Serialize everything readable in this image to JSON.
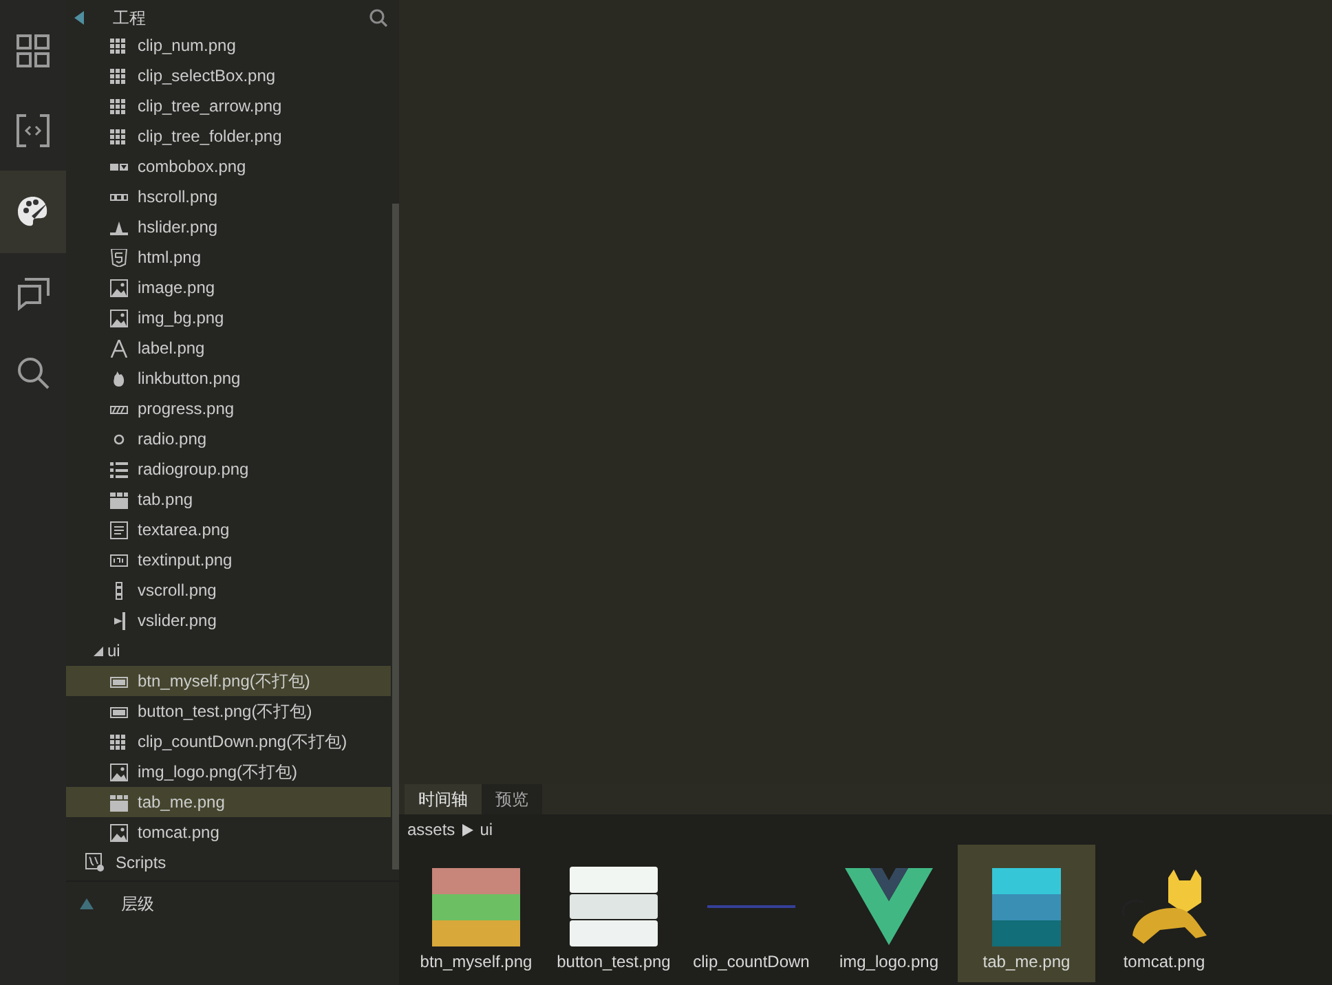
{
  "activity_bar": [
    {
      "kind": "grid",
      "selected": false
    },
    {
      "kind": "code",
      "selected": false
    },
    {
      "kind": "palette",
      "selected": true
    },
    {
      "kind": "chat",
      "selected": false
    },
    {
      "kind": "search",
      "selected": false
    }
  ],
  "project_panel": {
    "title": "工程",
    "expanded": true,
    "items": [
      {
        "label": "clip_num.png",
        "kind": "clip",
        "selected": false
      },
      {
        "label": "clip_selectBox.png",
        "kind": "clip",
        "selected": false
      },
      {
        "label": "clip_tree_arrow.png",
        "kind": "clip",
        "selected": false
      },
      {
        "label": "clip_tree_folder.png",
        "kind": "clip",
        "selected": false
      },
      {
        "label": "combobox.png",
        "kind": "combobox",
        "selected": false
      },
      {
        "label": "hscroll.png",
        "kind": "hscroll",
        "selected": false
      },
      {
        "label": "hslider.png",
        "kind": "hslider",
        "selected": false
      },
      {
        "label": "html.png",
        "kind": "html",
        "selected": false
      },
      {
        "label": "image.png",
        "selected": false
      },
      {
        "label": "img_bg.png",
        "selected": false
      },
      {
        "label": "label.png",
        "kind": "label",
        "selected": false
      },
      {
        "label": "linkbutton.png",
        "kind": "linkbutton",
        "selected": false
      },
      {
        "label": "progress.png",
        "kind": "progress",
        "selected": false
      },
      {
        "label": "radio.png",
        "kind": "radio",
        "selected": false
      },
      {
        "label": "radiogroup.png",
        "kind": "radiogroup",
        "selected": false
      },
      {
        "label": "tab.png",
        "kind": "tab",
        "selected": false
      },
      {
        "label": "textarea.png",
        "kind": "textarea",
        "selected": false
      },
      {
        "label": "textinput.png",
        "kind": "textinput",
        "selected": false
      },
      {
        "label": "vscroll.png",
        "kind": "vscroll",
        "selected": false
      },
      {
        "label": "vslider.png",
        "kind": "vslider",
        "selected": false
      },
      {
        "label": "ui",
        "kind": "folder",
        "expanded": true,
        "selected": false,
        "children": [
          {
            "label": "btn_myself.png(不打包)",
            "kind": "button",
            "selected": true
          },
          {
            "label": "button_test.png(不打包)",
            "kind": "button",
            "selected": false
          },
          {
            "label": "clip_countDown.png(不打包)",
            "kind": "clip",
            "selected": false
          },
          {
            "label": "img_logo.png(不打包)",
            "selected": false
          },
          {
            "label": "tab_me.png",
            "kind": "tab",
            "selected": true
          },
          {
            "label": "tomcat.png",
            "selected": false
          }
        ]
      }
    ],
    "scripts": {
      "label": "Scripts"
    }
  },
  "hierarchy_panel": {
    "title": "层级",
    "expanded": false
  },
  "bottom_panel": {
    "tabs": [
      {
        "label": "时间轴",
        "selected": true
      },
      {
        "label": "预览",
        "selected": false
      }
    ],
    "breadcrumb": [
      {
        "label": "assets"
      },
      {
        "label": "ui"
      }
    ],
    "assets": [
      {
        "label": "btn_myself.png",
        "kind": "stripes3",
        "selected": false
      },
      {
        "label": "button_test.png",
        "kind": "buttons",
        "selected": false
      },
      {
        "label": "clip_countDown",
        "kind": "digits",
        "selected": false
      },
      {
        "label": "img_logo.png",
        "kind": "chevron",
        "selected": false
      },
      {
        "label": "tab_me.png",
        "kind": "tabs",
        "selected": true
      },
      {
        "label": "tomcat.png",
        "kind": "cat",
        "selected": false
      }
    ]
  }
}
